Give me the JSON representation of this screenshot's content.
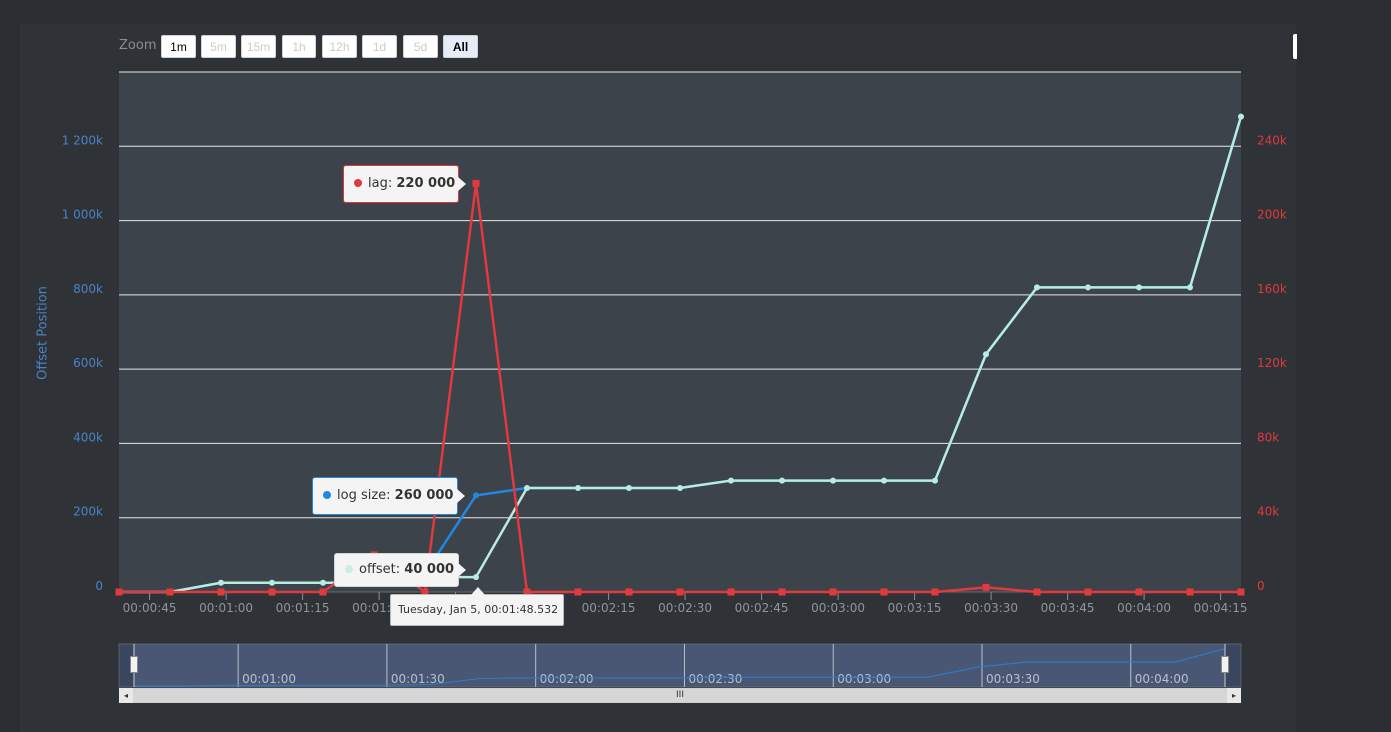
{
  "zoom": {
    "label": "Zoom",
    "buttons": [
      {
        "label": "1m",
        "enabled": true
      },
      {
        "label": "5m",
        "enabled": false
      },
      {
        "label": "15m",
        "enabled": false
      },
      {
        "label": "1h",
        "enabled": false
      },
      {
        "label": "12h",
        "enabled": false
      },
      {
        "label": "1d",
        "enabled": false
      },
      {
        "label": "5d",
        "enabled": false
      },
      {
        "label": "All",
        "enabled": true,
        "selected": true
      }
    ]
  },
  "tooltips": {
    "lag": {
      "name": "lag",
      "value": "220 000"
    },
    "log_size": {
      "name": "log size",
      "value": "260 000"
    },
    "offset": {
      "name": "offset",
      "value": "40 000"
    },
    "date": "Tuesday, Jan 5, 00:01:48.532"
  },
  "navigator": {
    "ticks": [
      "00:01:00",
      "00:01:30",
      "00:02:00",
      "00:02:30",
      "00:03:00",
      "00:03:30",
      "00:04:00"
    ],
    "scroll_grip": "III"
  },
  "colors": {
    "lag": "#e0393e",
    "log_size": "#1e88e5",
    "offset": "#b8ece0",
    "plot_bg": "#3d434b",
    "left_axis": "#4a82c3",
    "right_axis": "#e0393e"
  },
  "chart_data": {
    "type": "line",
    "title": "",
    "x_axis": {
      "ticks": [
        "00:00:45",
        "00:01:00",
        "00:01:15",
        "00:01:30",
        "00:01:45",
        "00:02:00",
        "00:02:15",
        "00:02:30",
        "00:02:45",
        "00:03:00",
        "00:03:15",
        "00:03:30",
        "00:03:45",
        "00:04:00",
        "00:04:15"
      ],
      "range_seconds": [
        39,
        259
      ]
    },
    "y_axis_left": {
      "title": "Offset Position",
      "ticks": [
        "0",
        "200k",
        "400k",
        "600k",
        "800k",
        "1 000k",
        "1 200k"
      ],
      "range": [
        0,
        1400000
      ]
    },
    "y_axis_right": {
      "ticks": [
        "0",
        "40k",
        "80k",
        "120k",
        "160k",
        "200k",
        "240k"
      ],
      "range": [
        0,
        280000
      ]
    },
    "grid": true,
    "legend": false,
    "series": [
      {
        "name": "log size",
        "axis": "left",
        "x": [
          "00:00:39",
          "00:00:49",
          "00:00:59",
          "00:01:09",
          "00:01:19",
          "00:01:29",
          "00:01:39",
          "00:01:49",
          "00:01:59",
          "00:02:09",
          "00:02:19",
          "00:02:29",
          "00:02:39",
          "00:02:49",
          "00:02:59",
          "00:03:09",
          "00:03:19",
          "00:03:29",
          "00:03:39",
          "00:03:49",
          "00:03:59",
          "00:04:09",
          "00:04:19"
        ],
        "values": [
          0,
          0,
          25000,
          25000,
          25000,
          25000,
          50000,
          260000,
          280000,
          280000,
          280000,
          280000,
          300000,
          300000,
          300000,
          300000,
          300000,
          640000,
          820000,
          820000,
          820000,
          820000,
          1280000
        ]
      },
      {
        "name": "offset",
        "axis": "left",
        "x": [
          "00:00:39",
          "00:00:49",
          "00:00:59",
          "00:01:09",
          "00:01:19",
          "00:01:29",
          "00:01:39",
          "00:01:49",
          "00:01:59",
          "00:02:09",
          "00:02:19",
          "00:02:29",
          "00:02:39",
          "00:02:49",
          "00:02:59",
          "00:03:09",
          "00:03:19",
          "00:03:29",
          "00:03:39",
          "00:03:49",
          "00:03:59",
          "00:04:09",
          "00:04:19"
        ],
        "values": [
          0,
          0,
          25000,
          25000,
          25000,
          25000,
          40000,
          40000,
          280000,
          280000,
          280000,
          280000,
          300000,
          300000,
          300000,
          300000,
          300000,
          640000,
          820000,
          820000,
          820000,
          820000,
          1280000
        ]
      },
      {
        "name": "lag",
        "axis": "right",
        "x": [
          "00:00:39",
          "00:00:49",
          "00:00:59",
          "00:01:09",
          "00:01:19",
          "00:01:29",
          "00:01:39",
          "00:01:49",
          "00:01:59",
          "00:02:09",
          "00:02:19",
          "00:02:29",
          "00:02:39",
          "00:02:49",
          "00:02:59",
          "00:03:09",
          "00:03:19",
          "00:03:29",
          "00:03:39",
          "00:03:49",
          "00:03:59",
          "00:04:09",
          "00:04:19"
        ],
        "values": [
          0,
          0,
          0,
          0,
          0,
          20000,
          0,
          220000,
          0,
          0,
          0,
          0,
          0,
          0,
          0,
          0,
          0,
          2500,
          0,
          0,
          0,
          0,
          0
        ]
      }
    ]
  }
}
